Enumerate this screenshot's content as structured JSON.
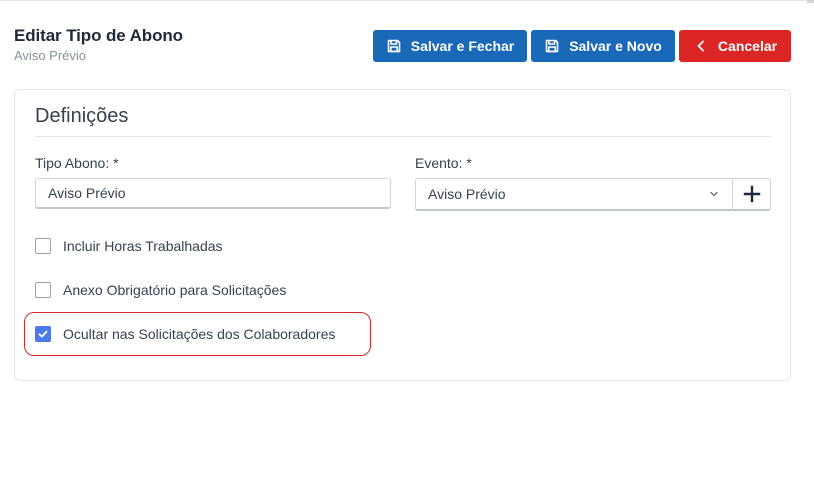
{
  "header": {
    "title": "Editar Tipo de Abono",
    "subtitle": "Aviso Prévio"
  },
  "toolbar": {
    "save_close_label": "Salvar e Fechar",
    "save_new_label": "Salvar e Novo",
    "cancel_label": "Cancelar",
    "save_icon": "floppy-disk-icon",
    "cancel_icon": "chevron-left-icon"
  },
  "form": {
    "section_title": "Definições",
    "tipo_abono": {
      "label": "Tipo Abono: *",
      "value": "Aviso Prévio"
    },
    "evento": {
      "label": "Evento: *",
      "selected": "Aviso Prévio",
      "add_icon": "plus-icon"
    },
    "checkboxes": [
      {
        "label": "Incluir Horas Trabalhadas",
        "checked": false
      },
      {
        "label": "Anexo Obrigatório para Solicitações",
        "checked": false
      },
      {
        "label": "Ocultar nas Solicitações dos Colaboradores",
        "checked": true
      }
    ]
  },
  "colors": {
    "primary": "#1a68b8",
    "danger": "#dc2626",
    "checkbox_checked": "#4b7bec",
    "highlight": "#dc2626"
  }
}
